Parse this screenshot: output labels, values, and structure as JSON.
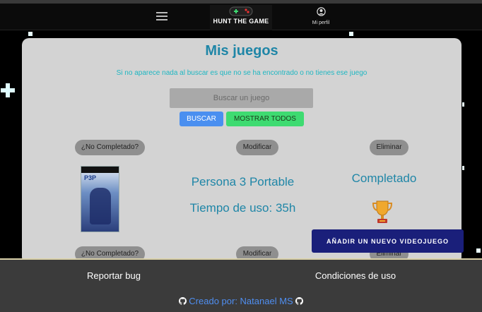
{
  "navbar": {
    "brand": "HUNT THE GAME",
    "profile_label": "Mi perfil",
    "icons": {
      "menu": "hamburger-icon",
      "logo": "gamepad-logo-icon",
      "profile": "user-circle-icon"
    }
  },
  "main": {
    "title": "Mis juegos",
    "note": "Si no aparece nada al buscar es que no se ha encontrado o no tienes ese juego",
    "search": {
      "placeholder": "Buscar un juego",
      "value": ""
    },
    "search_button": "BUSCAR",
    "show_all_button": "MOSTRAR TODOS"
  },
  "games": [
    {
      "toggle_label": "¿No Completado?",
      "edit_label": "Modificar",
      "delete_label": "Eliminar",
      "cover_text": "P3P",
      "title": "Persona 3 Portable",
      "time": "Tiempo de uso: 35h",
      "status": "Completado",
      "status_icon": "trophy-icon"
    },
    {
      "toggle_label": "¿No Completado?",
      "edit_label": "Modificar",
      "delete_label": "Eliminar"
    }
  ],
  "fab_label": "AÑADIR UN NUEVO VIDEOJUEGO",
  "footer": {
    "report_bug": "Reportar bug",
    "terms": "Condiciones de uso",
    "credit": "Creado por: Natanael MS",
    "credit_icon": "github-icon"
  },
  "colors": {
    "accent": "#1f86a7",
    "note": "#1fb7c2",
    "search_button": "#4a8ff0",
    "show_all_button": "#3edb71",
    "fab": "#1a1f7a",
    "footer": "#3b3b3b",
    "credit": "#4f8ef0"
  }
}
